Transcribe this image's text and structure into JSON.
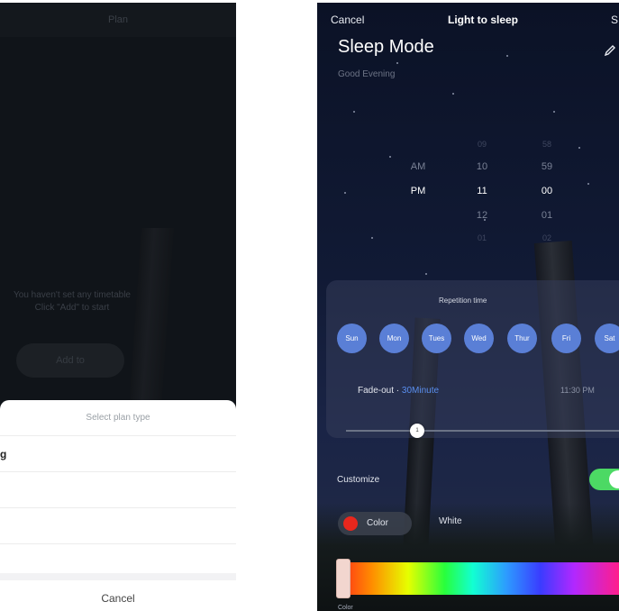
{
  "plan_screen": {
    "header_title": "Plan",
    "empty_line1": "You haven't set any timetable",
    "empty_line2": "Click \"Add\" to start",
    "add_button": "Add to",
    "sheet": {
      "title": "Select plan type",
      "first_option": "g",
      "cancel": "Cancel"
    }
  },
  "sleep_screen": {
    "topbar": {
      "cancel": "Cancel",
      "title": "Light to sleep",
      "save": "S"
    },
    "mode_name": "Sleep Mode",
    "greeting": "Good Evening",
    "edit_icon": "pencil-icon",
    "time_picker": {
      "ampm": {
        "above": "AM",
        "selected": "PM"
      },
      "hours": {
        "above2": "09",
        "above1": "10",
        "selected": "11",
        "below1": "12",
        "below2": "01"
      },
      "minutes": {
        "above2": "58",
        "above1": "59",
        "selected": "00",
        "below1": "01",
        "below2": "02"
      }
    },
    "repetition_title": "Repetition time",
    "days": [
      "Sun",
      "Mon",
      "Tues",
      "Wed",
      "Thur",
      "Fri",
      "Sat"
    ],
    "fade_label": "Fade-out · ",
    "fade_value": "30Minute",
    "fade_end_time": "11:30 PM",
    "slider_thumb_label": "1",
    "customize_label": "Customize",
    "customize_enabled": true,
    "color_tab": "Color",
    "white_tab": "White",
    "spectrum_label": "Color",
    "colors": {
      "day_chip": "#5a7fd6",
      "toggle_on": "#4cd964",
      "selected_color": "#e8271d",
      "fade_value": "#5a8ff0"
    }
  }
}
